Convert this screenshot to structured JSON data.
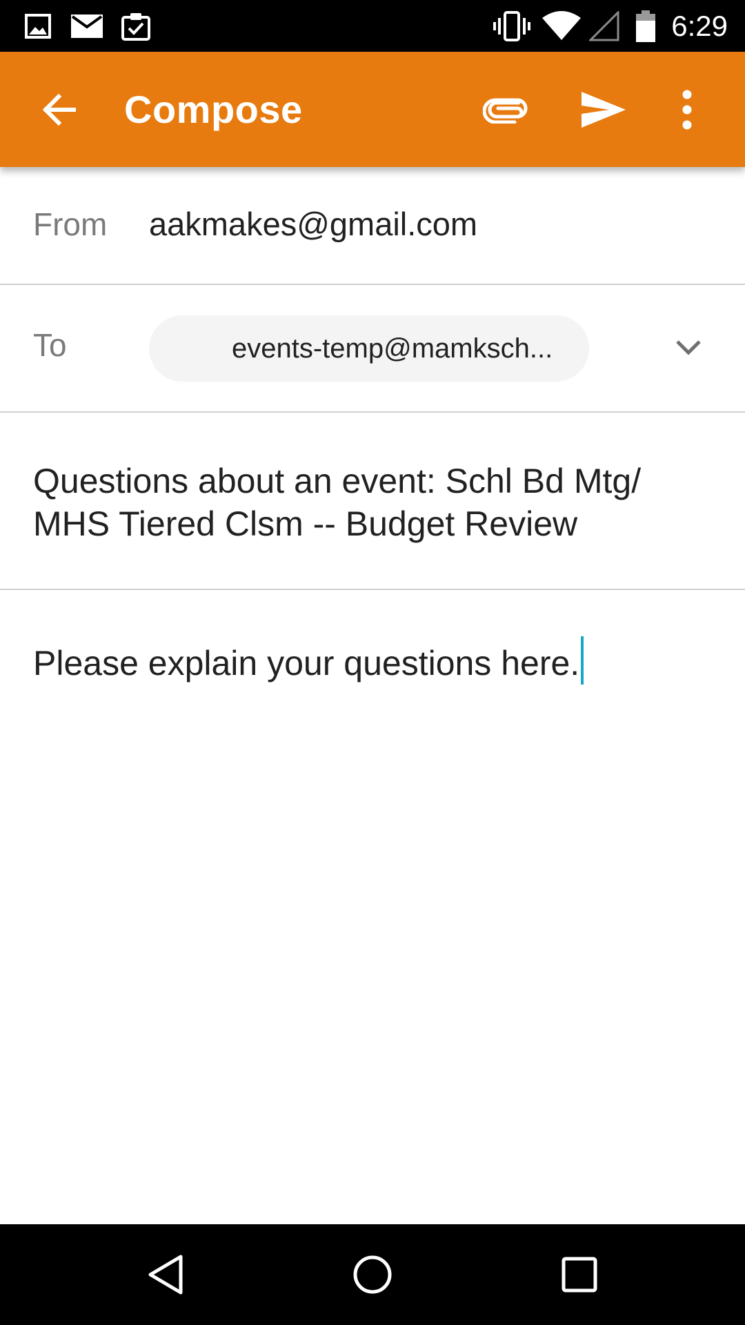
{
  "status_bar": {
    "time": "6:29",
    "icons": [
      "image-icon",
      "mail-icon",
      "clipboard-check-icon",
      "vibrate-icon",
      "wifi-icon",
      "signal-icon",
      "battery-icon"
    ]
  },
  "app_bar": {
    "title": "Compose",
    "actions": [
      "back-arrow-icon",
      "attach-icon",
      "send-icon",
      "more-vert-icon"
    ],
    "color": "#e87b10"
  },
  "compose": {
    "from_label": "From",
    "from_value": "aakmakes@gmail.com",
    "to_label": "To",
    "to_recipient": "events-temp@mamksch...",
    "subject": "Questions about an event: Schl Bd Mtg/ MHS Tiered Clsm -- Budget Review",
    "body": "Please explain your questions here."
  },
  "nav_bar": {
    "buttons": [
      "back-triangle-icon",
      "home-circle-icon",
      "recents-square-icon"
    ]
  },
  "colors": {
    "accent": "#e87b10",
    "caret": "#1aa6c8",
    "divider": "#cfcfcf"
  }
}
